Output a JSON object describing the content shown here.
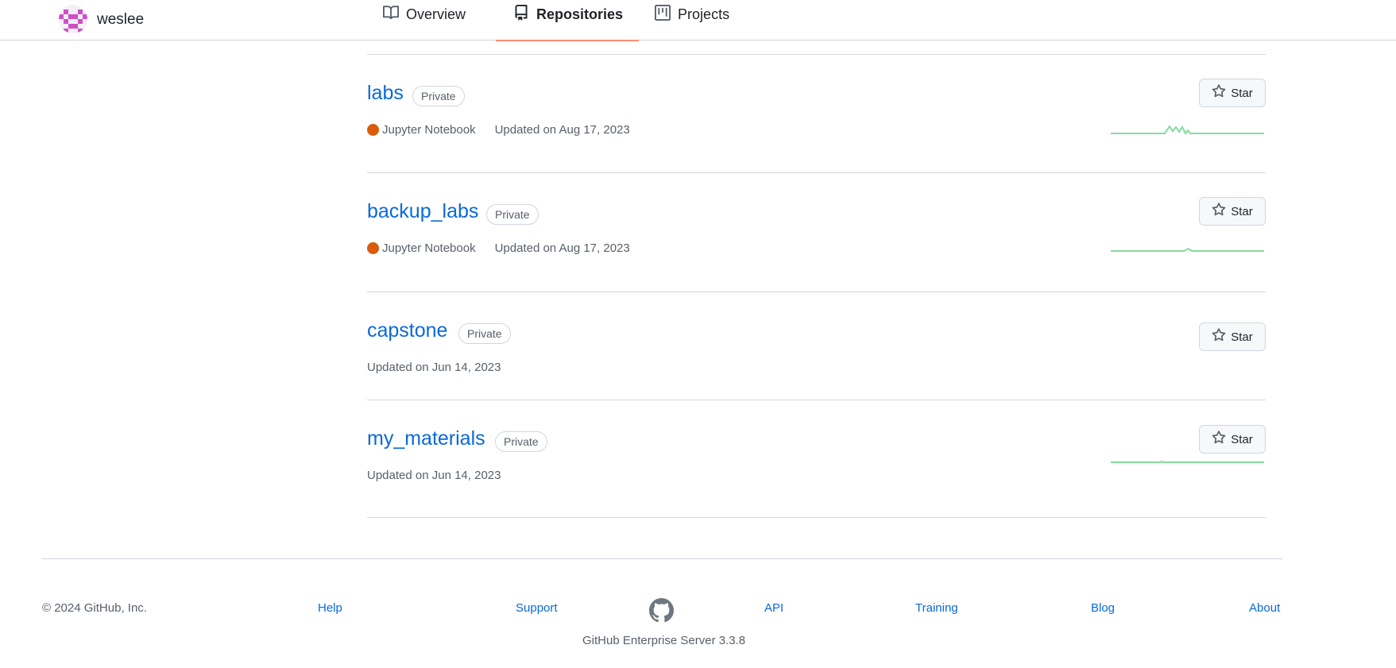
{
  "header": {
    "username": "weslee",
    "tabs": [
      {
        "label": "Overview",
        "icon": "book-icon"
      },
      {
        "label": "Repositories",
        "icon": "repo-icon",
        "selected": true
      },
      {
        "label": "Projects",
        "icon": "project-icon"
      }
    ]
  },
  "colors": {
    "accent_link": "#0969da",
    "tab_underline": "#fd8c73",
    "jupyter": "#DA5B0B",
    "sparkline": "#84dba0"
  },
  "repos": [
    {
      "name": "labs",
      "visibility": "Private",
      "language": "Jupyter Notebook",
      "updated": "Updated on Aug 17, 2023",
      "star_label": "Star"
    },
    {
      "name": "backup_labs",
      "visibility": "Private",
      "language": "Jupyter Notebook",
      "updated": "Updated on Aug 17, 2023",
      "star_label": "Star"
    },
    {
      "name": "capstone",
      "visibility": "Private",
      "language": null,
      "updated": "Updated on Jun 14, 2023",
      "star_label": "Star"
    },
    {
      "name": "my_materials",
      "visibility": "Private",
      "language": null,
      "updated": "Updated on Jun 14, 2023",
      "star_label": "Star"
    }
  ],
  "footer": {
    "copyright": "© 2024 GitHub, Inc.",
    "links": [
      "Help",
      "Support",
      "API",
      "Training",
      "Blog",
      "About"
    ],
    "server_version": "GitHub Enterprise Server 3.3.8"
  }
}
